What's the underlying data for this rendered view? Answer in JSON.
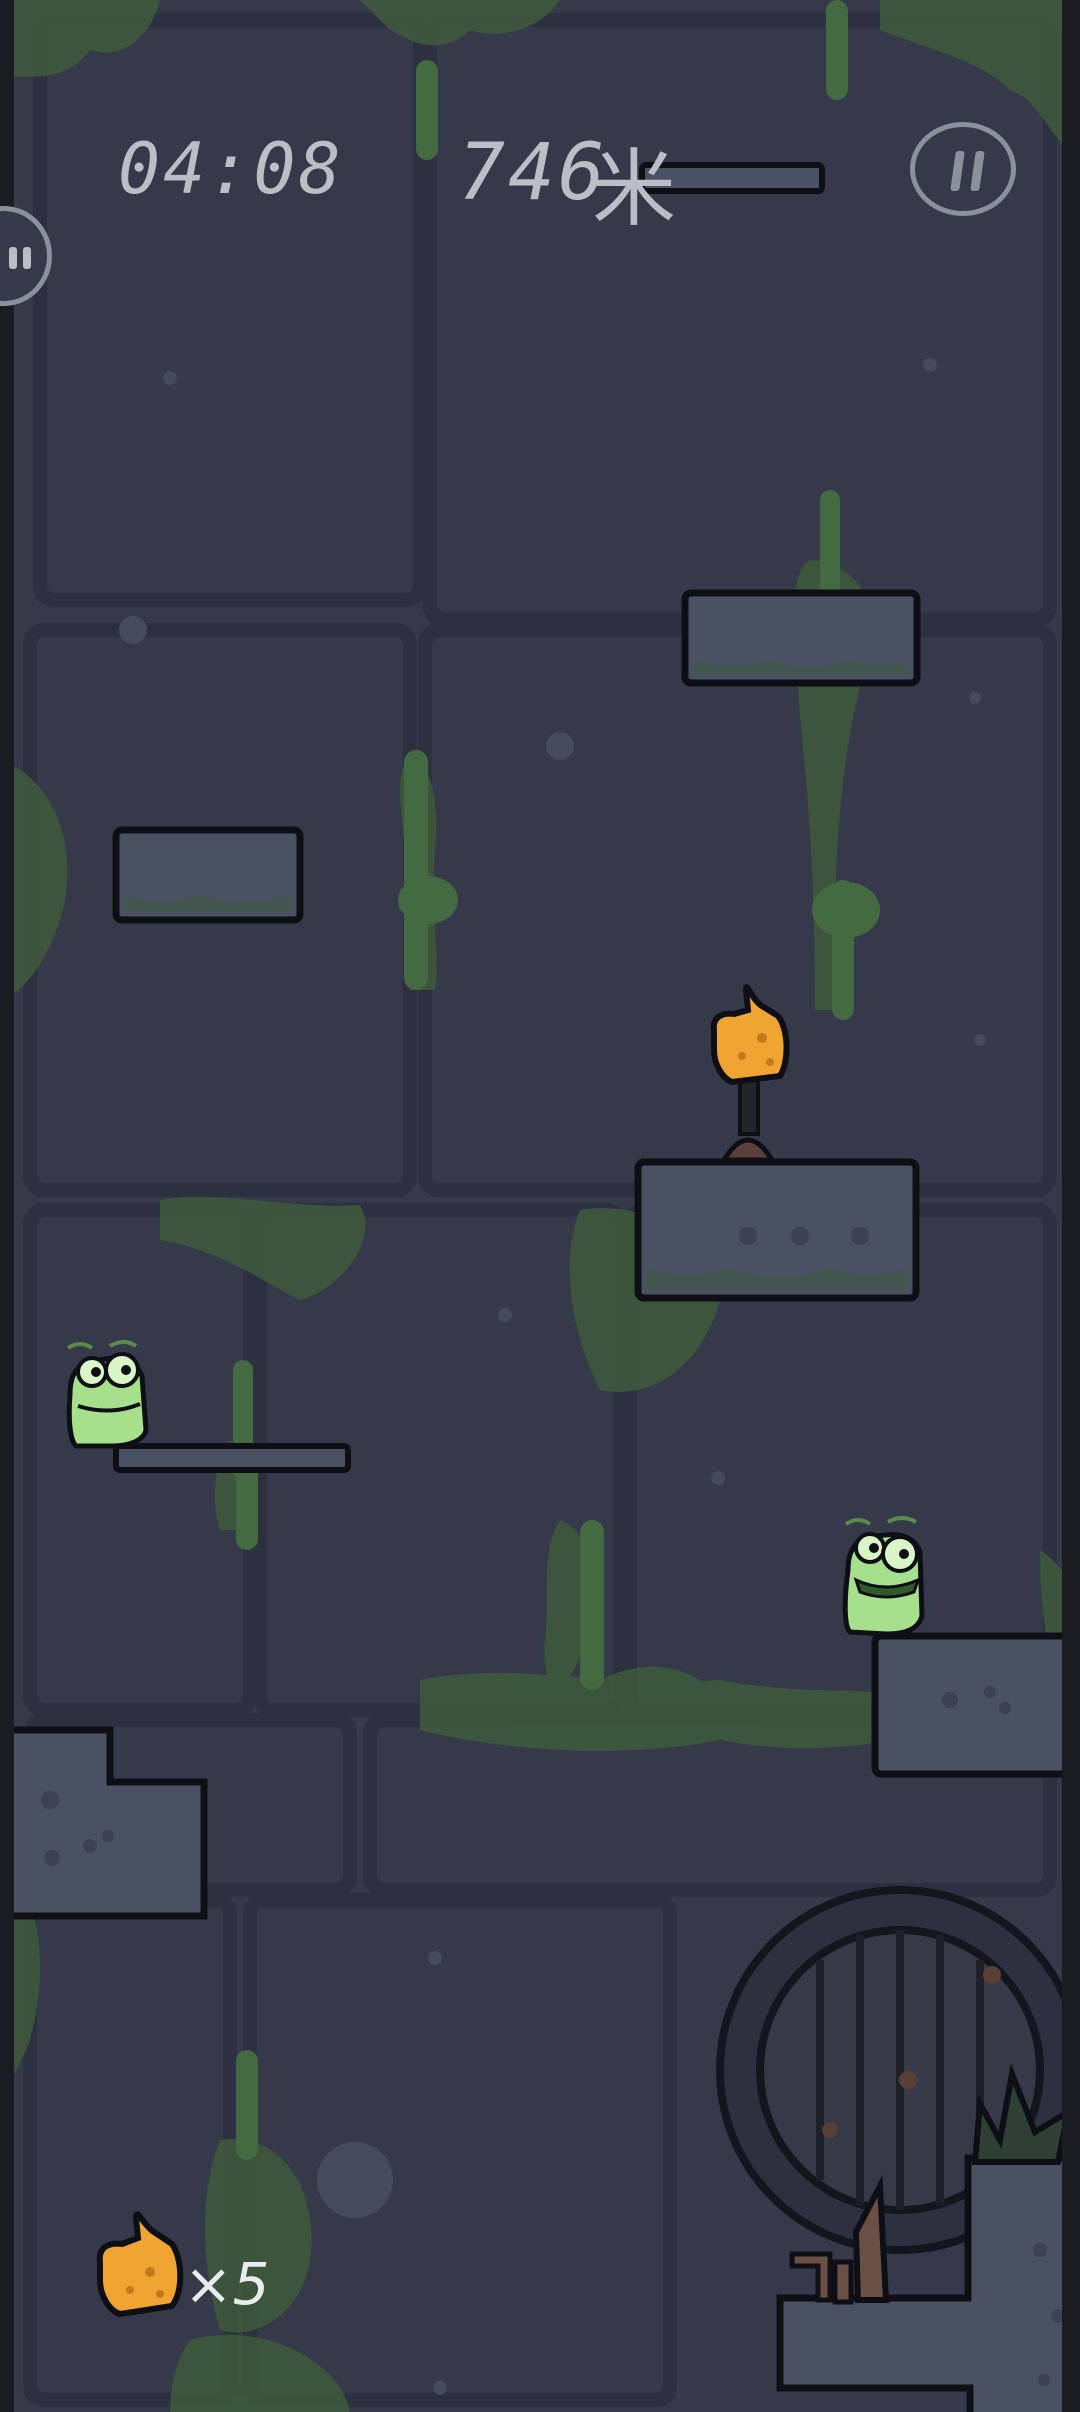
{
  "hud": {
    "timer": "04:08",
    "distance": "746",
    "distance_unit": "米"
  },
  "inventory": {
    "item_icon": "thumbs-up-icon",
    "count_label": "×5"
  },
  "colors": {
    "background": "#35394a",
    "platform_fill": "#4a5163",
    "platform_outline": "#0e0f14",
    "moss": "#3e5a3b",
    "frog_green": "#a7e08d",
    "thumb_orange": "#f0a431"
  }
}
